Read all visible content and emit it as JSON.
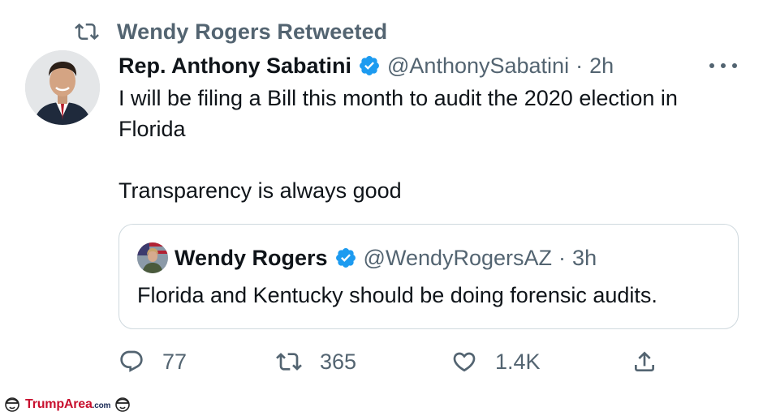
{
  "retweet_banner": {
    "text": "Wendy Rogers Retweeted",
    "icon": "retweet-icon"
  },
  "tweet": {
    "author_name": "Rep. Anthony Sabatini",
    "handle": "@AnthonySabatini",
    "separator": "·",
    "time": "2h",
    "verified": true,
    "body_line1": "I will be filing a Bill this month to audit the 2020 election in",
    "body_line2": "Florida",
    "body_line3": "Transparency is always good"
  },
  "quoted_tweet": {
    "author_name": "Wendy Rogers",
    "handle": "@WendyRogersAZ",
    "separator": "·",
    "time": "3h",
    "verified": true,
    "text": "Florida and Kentucky should be doing forensic audits."
  },
  "actions": {
    "reply_count": "77",
    "retweet_count": "365",
    "like_count": "1.4K"
  },
  "watermark": {
    "brand": "TrumpArea",
    "suffix": ".com"
  },
  "colors": {
    "text_primary": "#0f1419",
    "text_secondary": "#536471",
    "verified_blue": "#1d9bf0",
    "border": "#cfd9de",
    "watermark_red": "#c8102e"
  }
}
